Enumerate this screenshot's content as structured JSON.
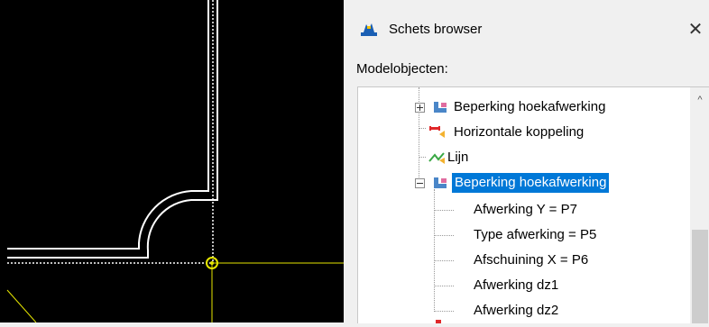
{
  "panel": {
    "title": "Schets browser",
    "close_symbol": "✕",
    "icon": "sketch-browser-icon",
    "section_label": "Modelobjecten:"
  },
  "tree": {
    "items": [
      {
        "label": "Beperking hoekafwerking",
        "icon": "constraint-icon",
        "expander": "plus",
        "selected": false
      },
      {
        "label": "Horizontale koppeling",
        "icon": "horizontal-link-icon",
        "expander": "",
        "selected": false
      },
      {
        "label": "Lijn",
        "icon": "line-icon",
        "expander": "",
        "selected": false
      },
      {
        "label": "Beperking hoekafwerking",
        "icon": "constraint-icon",
        "expander": "minus",
        "selected": true
      }
    ],
    "children": [
      {
        "label": "Afwerking Y = P7"
      },
      {
        "label": "Type afwerking = P5"
      },
      {
        "label": "Afschuining X = P6"
      },
      {
        "label": "Afwerking dz1"
      },
      {
        "label": "Afwerking dz2"
      }
    ],
    "scroll_up_symbol": "^"
  },
  "colors": {
    "canvas_bg": "#000000",
    "sketch_line": "#ffffff",
    "guide_line": "#e6e600",
    "selection": "#0078d7"
  }
}
